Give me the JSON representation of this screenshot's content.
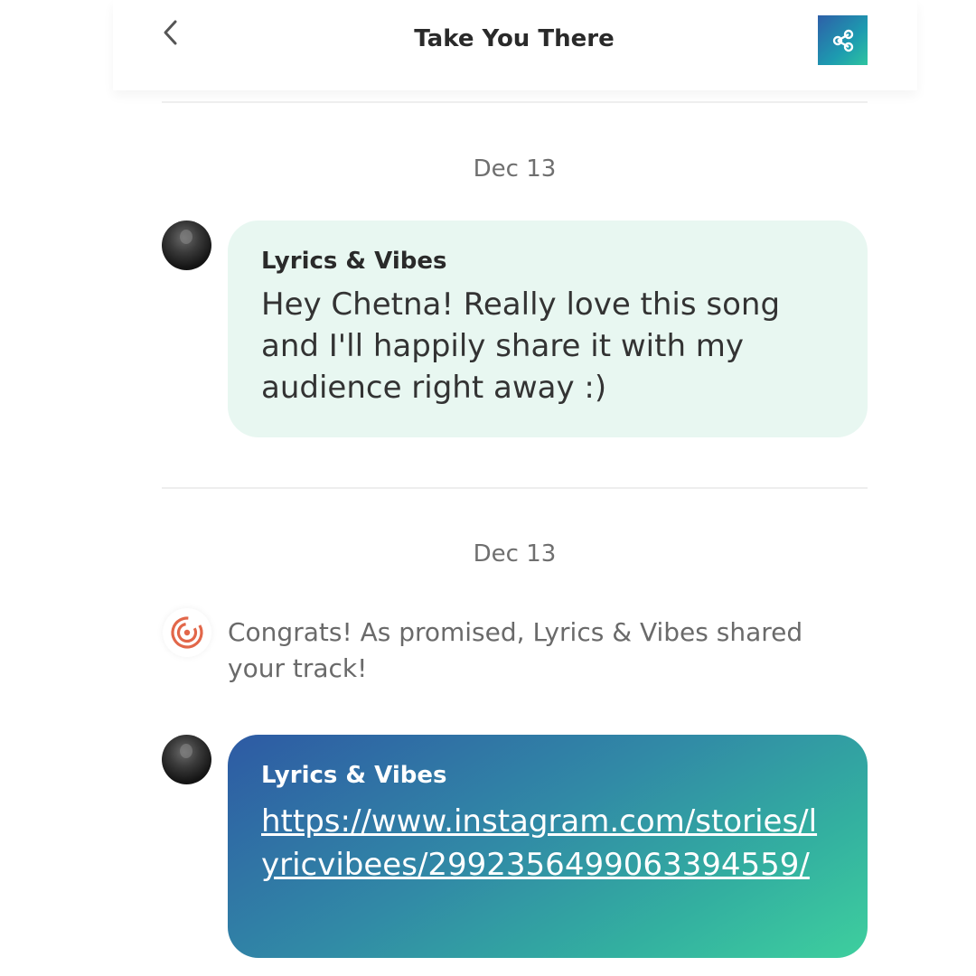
{
  "header": {
    "title": "Take You There",
    "back_icon": "chevron-left-icon",
    "share_icon": "share-icon"
  },
  "messages": [
    {
      "date": "Dec 13",
      "sender": "Lyrics & Vibes",
      "text": "Hey Chetna! Really love this song and I'll happily share it with my audience right away :)"
    },
    {
      "date": "Dec 13",
      "system_text": "Congrats! As promised, Lyrics & Vibes shared your track!",
      "system_icon": "target-icon",
      "sender": "Lyrics & Vibes",
      "link": "https://www.instagram.com/stories/lyricvibees/2992356499063394559/"
    }
  ],
  "colors": {
    "accent_gradient_start": "#2e5aa4",
    "accent_gradient_end": "#3ecf9e",
    "bubble_light": "#e8f7f1",
    "system_icon": "#e2674a"
  }
}
